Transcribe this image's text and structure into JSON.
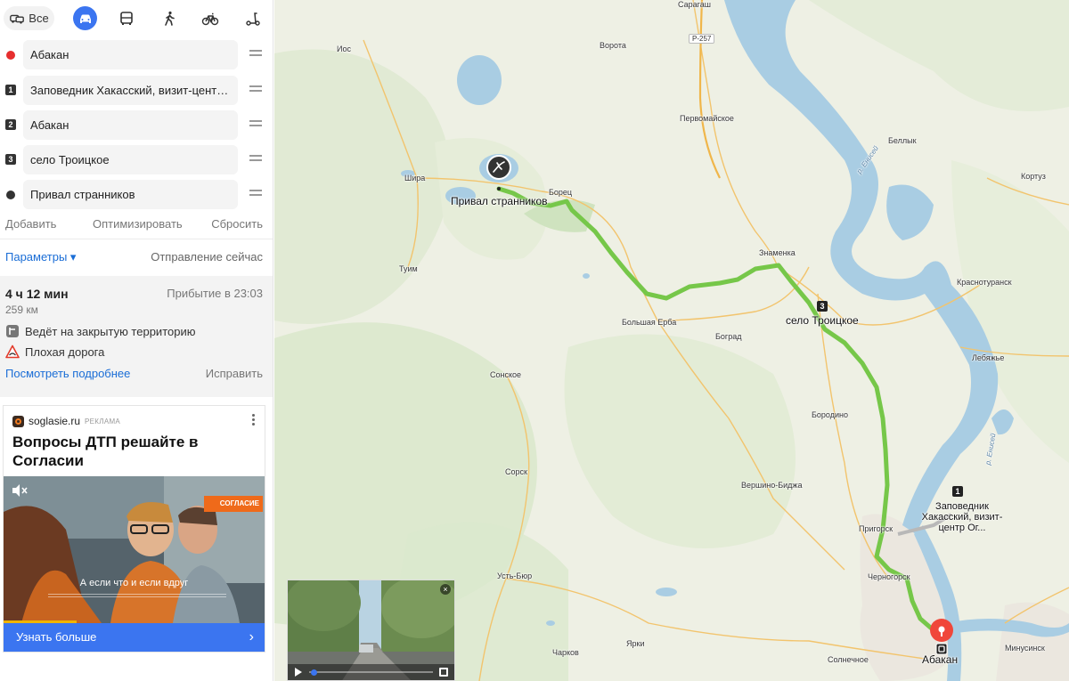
{
  "modes": {
    "all_label": "Все",
    "active": "car"
  },
  "waypoints": [
    {
      "marker": "start",
      "value": "Абакан"
    },
    {
      "marker": "1",
      "value": "Заповедник Хакасский, визит-центр Ог..."
    },
    {
      "marker": "2",
      "value": "Абакан"
    },
    {
      "marker": "3",
      "value": "село Троицкое"
    },
    {
      "marker": "end",
      "value": "Привал странников"
    }
  ],
  "actions": {
    "add": "Добавить",
    "optimize": "Оптимизировать",
    "reset": "Сбросить"
  },
  "params": {
    "label": "Параметры ▾",
    "departure": "Отправление сейчас"
  },
  "route": {
    "duration": "4 ч 12 мин",
    "arrival": "Прибытие в 23:03",
    "distance": "259 км",
    "warnings": [
      "Ведёт на закрытую территорию",
      "Плохая дорога"
    ],
    "more": "Посмотреть подробнее",
    "fix": "Исправить"
  },
  "ad": {
    "domain": "soglasie.ru",
    "tag": "РЕКЛАМА",
    "title": "Вопросы ДТП решайте в Согласии",
    "brand": "СОГЛАСИЕ",
    "subtitle": "А если что и если вдруг",
    "progress": 0.28,
    "cta": "Узнать больше"
  },
  "map": {
    "labels": {
      "saragash": "Сарагаш",
      "ios": "Иос",
      "vorota": "Ворота",
      "pervomayskoe": "Первомайское",
      "bellyk": "Беллык",
      "kortuz": "Кортуз",
      "shira": "Шира",
      "borets": "Борец",
      "privale": "Привал странников",
      "tuim": "Туим",
      "znamenka": "Знаменка",
      "krasnoturansk": "Краснотуранск",
      "troitskoe": "село Троицкое",
      "bolshaya_erba": "Большая Ерба",
      "bograd": "Боград",
      "lebyazhe": "Лебяжье",
      "sonskoe": "Сонское",
      "borodino": "Бородино",
      "sorsk": "Сорск",
      "vershino": "Вершино-Биджа",
      "zapovednik": "Заповедник Хакасский, визит-центр Ог...",
      "prigorsk": "Пригорск",
      "chernogorsk": "Черногорск",
      "ust_byur": "Усть-Бюр",
      "abakan": "Абакан",
      "minusinsk": "Минусинск",
      "charkov": "Чарков",
      "yarki": "Ярки",
      "solnechnoe": "Солнечное",
      "yenisei_1": "р. Енисей",
      "yenisei_2": "р. Енисей"
    },
    "road_shield": "Р-257",
    "waypoint_badges": [
      "1",
      "3"
    ]
  }
}
